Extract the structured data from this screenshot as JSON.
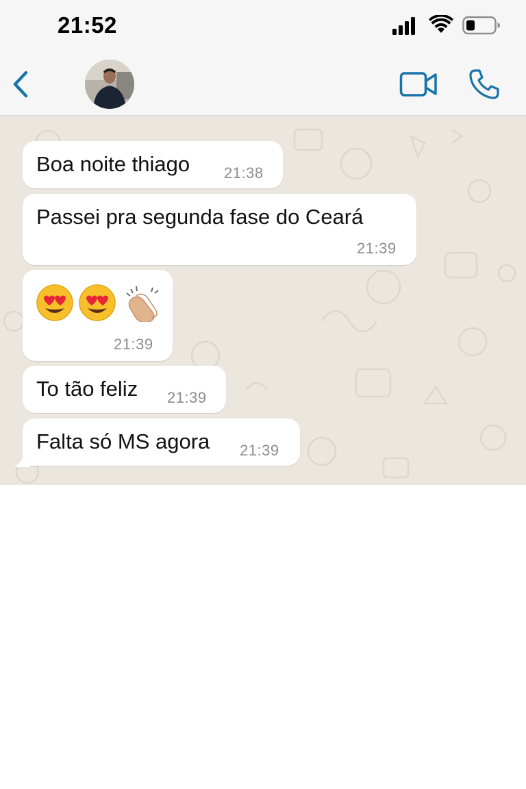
{
  "status_bar": {
    "time": "21:52",
    "signal_icon": "cellular-signal-icon",
    "wifi_icon": "wifi-icon",
    "battery_icon": "battery-low-icon"
  },
  "header": {
    "back_icon": "chevron-left-icon",
    "avatar": "contact-avatar",
    "video_icon": "video-camera-icon",
    "phone_icon": "phone-icon",
    "accent_color": "#1a73a8"
  },
  "messages": [
    {
      "text": "Boa noite thiago",
      "time": "21:38"
    },
    {
      "text": "Passei pra segunda fase do Ceará",
      "time": "21:39"
    },
    {
      "emojis": [
        "😍",
        "😍",
        "👏"
      ],
      "time": "21:39"
    },
    {
      "text": "To tão feliz",
      "time": "21:39"
    },
    {
      "text": "Falta só MS agora",
      "time": "21:39"
    }
  ],
  "colors": {
    "chat_background": "#ebe6de",
    "bubble": "#ffffff",
    "header_background": "#f6f6f6",
    "timestamp": "#8c8c8c"
  }
}
